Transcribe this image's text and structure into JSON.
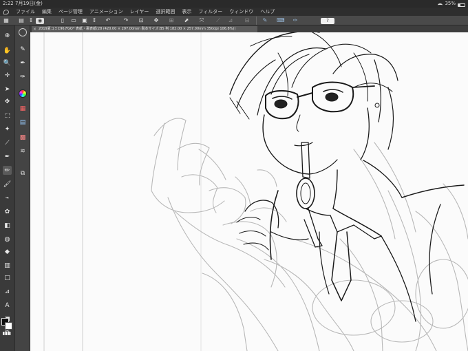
{
  "status_bar": {
    "time": "2:22",
    "date": "7月19日(金)",
    "battery": "35%",
    "battery_level": 0.35
  },
  "menu": {
    "items": [
      "ファイル",
      "編集",
      "ページ管理",
      "アニメーション",
      "レイヤー",
      "選択範囲",
      "表示",
      "フィルター",
      "ウィンドウ",
      "ヘルプ"
    ]
  },
  "document": {
    "tab_title": "2019夏コミC96,FGO* 表紙・裏表紙(28 (420.00 × 297.00mm 製本サイズ:B5 判 182.00 × 257.00mm 350dpi 106.8%))"
  },
  "colors": {
    "main_color": "#111111",
    "sub_color": "#ffffff"
  }
}
